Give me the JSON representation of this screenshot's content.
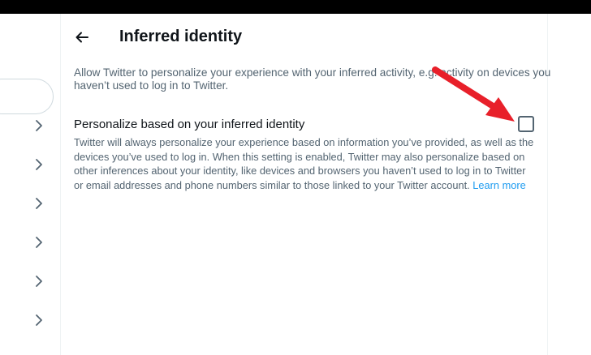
{
  "header": {
    "title": "Inferred identity",
    "back_icon": "arrow-left-icon"
  },
  "intro_text": "Allow Twitter to personalize your experience with your inferred activity, e.g. activity on devices you haven’t used to log in to Twitter.",
  "setting": {
    "label": "Personalize based on your inferred identity",
    "checked": false,
    "description": "Twitter will always personalize your experience based on information you’ve provided, as well as the devices you’ve used to log in. When this setting is enabled, Twitter may also personalize based on other inferences about your identity, like devices and browsers you haven’t used to log in to Twitter or email addresses and phone numbers similar to those linked to your Twitter account.",
    "learn_more": "Learn more"
  },
  "left_menu": {
    "item_icon": "chevron-right-icon",
    "item_count": 6
  },
  "colors": {
    "annotation_arrow": "#e8202a",
    "link": "#1d9bf0",
    "secondary_text": "#536471"
  }
}
